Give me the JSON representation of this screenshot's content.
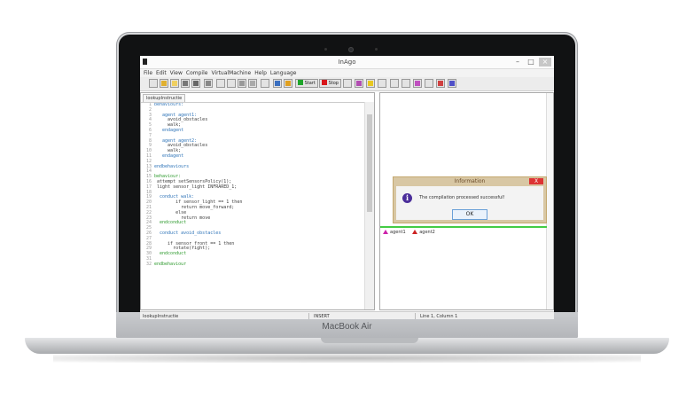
{
  "device": {
    "brand": "MacBook Air"
  },
  "window": {
    "title": "InAgo",
    "buttons": {
      "minimize": "–",
      "maximize": "□",
      "close": "×"
    }
  },
  "menu": [
    "File",
    "Edit",
    "View",
    "Compile",
    "VirtualMachine",
    "Help",
    "Language"
  ],
  "toolbar": {
    "start_label": "Start",
    "stop_label": "Stop",
    "start_color": "#1fa52b",
    "stop_color": "#d8161b"
  },
  "editor": {
    "tab": "lookupInstructie",
    "lines": [
      {
        "n": "1",
        "text": "behaviours:",
        "cls": "kw"
      },
      {
        "n": "2",
        "text": "",
        "cls": "tx"
      },
      {
        "n": "3",
        "text": "   agent agent1:",
        "cls": "kw"
      },
      {
        "n": "4",
        "text": "     avoid_obstacles",
        "cls": "tx"
      },
      {
        "n": "5",
        "text": "     walk;",
        "cls": "tx"
      },
      {
        "n": "6",
        "text": "   endagent",
        "cls": "kw"
      },
      {
        "n": "7",
        "text": "",
        "cls": "tx"
      },
      {
        "n": "8",
        "text": "   agent agent2:",
        "cls": "kw"
      },
      {
        "n": "9",
        "text": "     avoid_obstacles",
        "cls": "tx"
      },
      {
        "n": "10",
        "text": "     walk;",
        "cls": "tx"
      },
      {
        "n": "11",
        "text": "   endagent",
        "cls": "kw"
      },
      {
        "n": "12",
        "text": "",
        "cls": "tx"
      },
      {
        "n": "13",
        "text": "endbehaviours",
        "cls": "kw"
      },
      {
        "n": "14",
        "text": "",
        "cls": "tx"
      },
      {
        "n": "15",
        "text": "behaviour:",
        "cls": "gr"
      },
      {
        "n": "16",
        "text": " attempt setSensorsPolicy(1);",
        "cls": "tx"
      },
      {
        "n": "17",
        "text": " light sensor_light INFRARED_1;",
        "cls": "tx"
      },
      {
        "n": "18",
        "text": "",
        "cls": "tx"
      },
      {
        "n": "19",
        "text": "  conduct walk:",
        "cls": "kw"
      },
      {
        "n": "20",
        "text": "        if sensor_light == 1 then",
        "cls": "tx"
      },
      {
        "n": "21",
        "text": "          return move_forward;",
        "cls": "tx"
      },
      {
        "n": "22",
        "text": "        else",
        "cls": "tx"
      },
      {
        "n": "23",
        "text": "          return move",
        "cls": "tx"
      },
      {
        "n": "24",
        "text": "  endconduct",
        "cls": "gr"
      },
      {
        "n": "25",
        "text": "",
        "cls": "tx"
      },
      {
        "n": "26",
        "text": "  conduct avoid_obstacles",
        "cls": "kw"
      },
      {
        "n": "27",
        "text": "",
        "cls": "tx"
      },
      {
        "n": "28",
        "text": "     if sensor_front == 1 then",
        "cls": "tx"
      },
      {
        "n": "29",
        "text": "       rotate(right);",
        "cls": "tx"
      },
      {
        "n": "30",
        "text": "  endconduct",
        "cls": "gr"
      },
      {
        "n": "31",
        "text": "",
        "cls": "tx"
      },
      {
        "n": "32",
        "text": "endbehaviour",
        "cls": "gr"
      }
    ]
  },
  "rightpane": {
    "agents": [
      "agent1",
      "agent2"
    ]
  },
  "dialog": {
    "title": "Information",
    "message": "The compilation processed successful!",
    "ok": "OK",
    "close": "X"
  },
  "status": {
    "left": "lookupInstructie",
    "middle": "INSERT",
    "right": "Line 1, Column 1"
  }
}
